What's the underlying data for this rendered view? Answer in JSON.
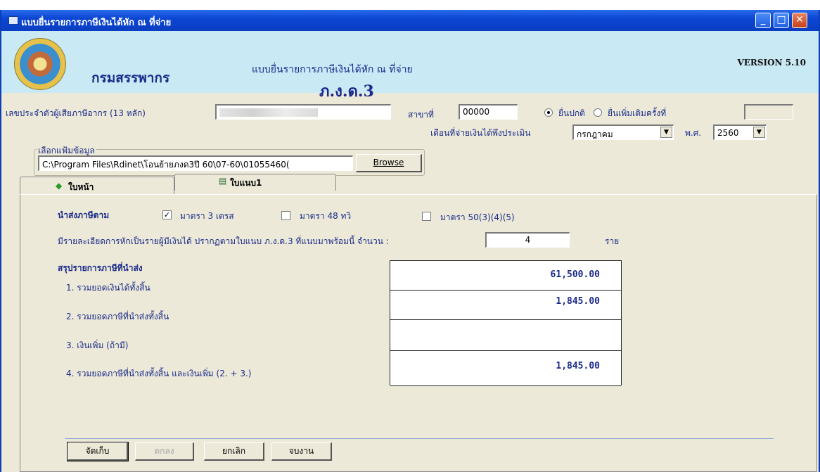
{
  "window": {
    "title": "แบบยื่นรายการภาษีเงินได้หัก ณ ที่จ่าย",
    "minimize": "_",
    "maximize": "□",
    "close": "✕"
  },
  "header": {
    "dept": "กรมสรรพากร",
    "form_title": "แบบยื่นรายการภาษีเงินได้หัก ณ ที่จ่าย",
    "form_code": "ภ.ง.ด.3",
    "version": "VERSION 5.10"
  },
  "taxpayer": {
    "id_label": "เลขประจำตัวผู้เสียภาษีอากร (13 หลัก)",
    "branch_label": "สาขาที่",
    "branch_value": "00000",
    "filing_normal": "ยื่นปกติ",
    "filing_extra": "ยื่นเพิ่มเติมครั้งที่"
  },
  "file": {
    "group_label": "เลือกแฟ้มข้อมูล",
    "path": "C:\\Program Files\\Rdinet\\โอนย้ายภงด3ปี 60\\07-60\\01055460(",
    "browse": "Browse"
  },
  "period": {
    "month_label": "เดือนที่จ่ายเงินได้พึงประเมิน",
    "month_value": "กรกฎาคม",
    "year_label": "พ.ศ.",
    "year_value": "2560"
  },
  "tabs": [
    {
      "label": "ใบหน้า"
    },
    {
      "label": "ใบแนบ1"
    }
  ],
  "submit": {
    "label": "นำส่งภาษีตาม",
    "options": [
      {
        "label": "มาตรา 3 เตรส",
        "checked": "✓"
      },
      {
        "label": "มาตรา 48 ทวิ",
        "checked": ""
      },
      {
        "label": "มาตรา 50(3)(4)(5)",
        "checked": ""
      }
    ]
  },
  "detail": {
    "text": "มีรายละเอียดการหักเป็นรายผู้มีเงินได้ ปรากฏตามใบแนบ ภ.ง.ด.3 ที่แนบมาพร้อมนี้ จำนวน :",
    "count": "4",
    "unit": "ราย"
  },
  "summary": {
    "title": "สรุปรายการภาษีที่นำส่ง",
    "rows": [
      {
        "label": "1. รวมยอดเงินได้ทั้งสิ้น",
        "value": "61,500.00"
      },
      {
        "label": "2. รวมยอดภาษีที่นำส่งทั้งสิ้น",
        "value": "1,845.00"
      },
      {
        "label": "3. เงินเพิ่ม (ถ้ามี)",
        "value": ""
      },
      {
        "label": "4. รวมยอดภาษีที่นำส่งทั้งสิ้น และเงินเพิ่ม (2. + 3.)",
        "value": "1,845.00"
      }
    ]
  },
  "buttons": {
    "save": "จัดเก็บ",
    "ok": "ตกลง",
    "cancel": "ยกเลิก",
    "finish": "จบงาน"
  },
  "colors": {
    "title_bar": "#0b46d3",
    "header_bg": "#c9e9f5",
    "accent_text": "#1a2a8a",
    "window_bg": "#ece9d8"
  }
}
